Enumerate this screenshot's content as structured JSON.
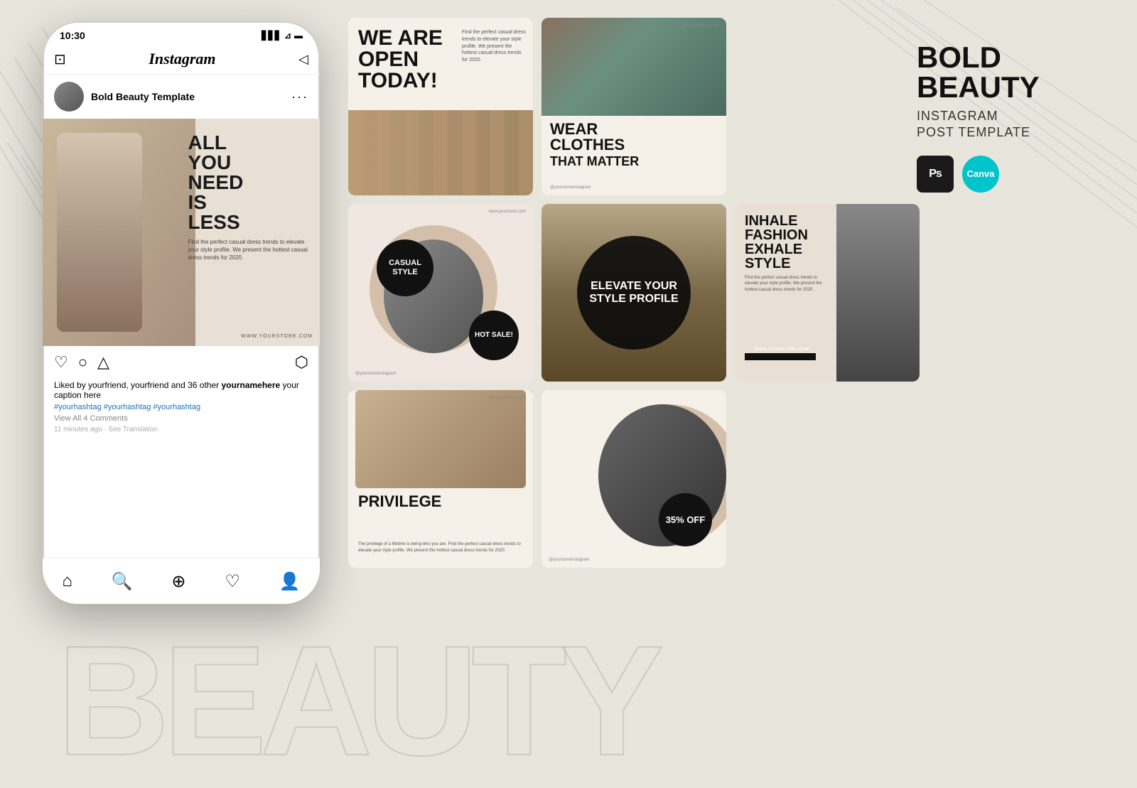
{
  "background_color": "#e8e5dc",
  "watermark": {
    "text": "BEAUTY"
  },
  "phone": {
    "time": "10:30",
    "app_name": "Instagram",
    "profile_name": "Bold Beauty Template",
    "post_headline_line1": "ALL",
    "post_headline_line2": "YOU",
    "post_headline_line3": "NEED",
    "post_headline_line4": "IS",
    "post_headline_line5": "LESS",
    "post_subtext": "Find the perfect casual dress trends to elevate your style profile. We present the hottest casual dress trends for 2020.",
    "post_website": "WWW.YOURSTORE.COM",
    "likes_text": "Liked by yourfriend, yourfriend and 36 other",
    "username": "yournamehere",
    "caption": "your caption here",
    "hashtags": "#yourhashtag #yourhashtag #yourhashtag",
    "view_comments": "View All 4 Comments",
    "timestamp": "11 minutes ago · See Translation"
  },
  "cards": [
    {
      "id": 1,
      "headline": "WE ARE OPEN TODAY!",
      "subtext": "Find the perfect casual dress trends to elevate your style profile. We present the hottest casual dress trends for 2020."
    },
    {
      "id": 2,
      "headline_line1": "WEAR",
      "headline_line2": "CLOTHES",
      "headline_line3": "THAT MATTER",
      "url": "www.yourstore.com",
      "handle": "@yourstoreinstagram"
    },
    {
      "id": 3,
      "badge_top": "CASUAL STYLE",
      "badge_bottom": "HOT SALE!",
      "url": "www.yourstore.com",
      "handle": "@yourstoreinstagram"
    },
    {
      "id": 4,
      "text": "ELEVATE YOUR STYLE PROFILE"
    },
    {
      "id": 5,
      "headline_line1": "INHALE",
      "headline_line2": "FASHION",
      "headline_line3": "EXHALE",
      "headline_line4": "STYLE",
      "subtext": "Find the perfect casual dress trends to elevate your style profile. We present the hottest casual dress trends for 2020.",
      "url": "WWW.YOURSTORE.COM"
    },
    {
      "id": 6,
      "headline": "PRIVILEGE",
      "subtext": "The privilege of a lifetime is being who you are. Find the perfect casual dress trends to elevate your style profile. We present the hottest casual dress trends for 2020.",
      "url": "www.yourstore.com"
    },
    {
      "id": 7,
      "badge": "35% OFF",
      "handle": "@yourstoreinstagram"
    }
  ],
  "right_panel": {
    "title_line1": "Bold",
    "title_line2": "Beauty",
    "subtitle": "INSTAGRAM\nPOST TEMPLATE",
    "ps_label": "Ps",
    "canva_label": "Canva"
  }
}
